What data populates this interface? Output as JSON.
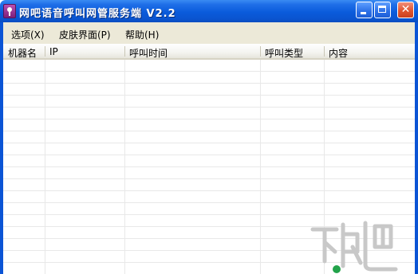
{
  "window": {
    "title": "网吧语音呼叫网管服务端 V2.2",
    "close_glyph": "✕"
  },
  "menu": [
    {
      "label": "选项(X)"
    },
    {
      "label": "皮肤界面(P)"
    },
    {
      "label": "帮助(H)"
    }
  ],
  "table": {
    "columns": [
      "机器名",
      "IP",
      "呼叫时间",
      "呼叫类型",
      "内容"
    ],
    "rows": []
  },
  "colors": {
    "titlebar": "#0a54cf",
    "menubar": "#ece9d8",
    "gridline": "#e8e8e8"
  }
}
